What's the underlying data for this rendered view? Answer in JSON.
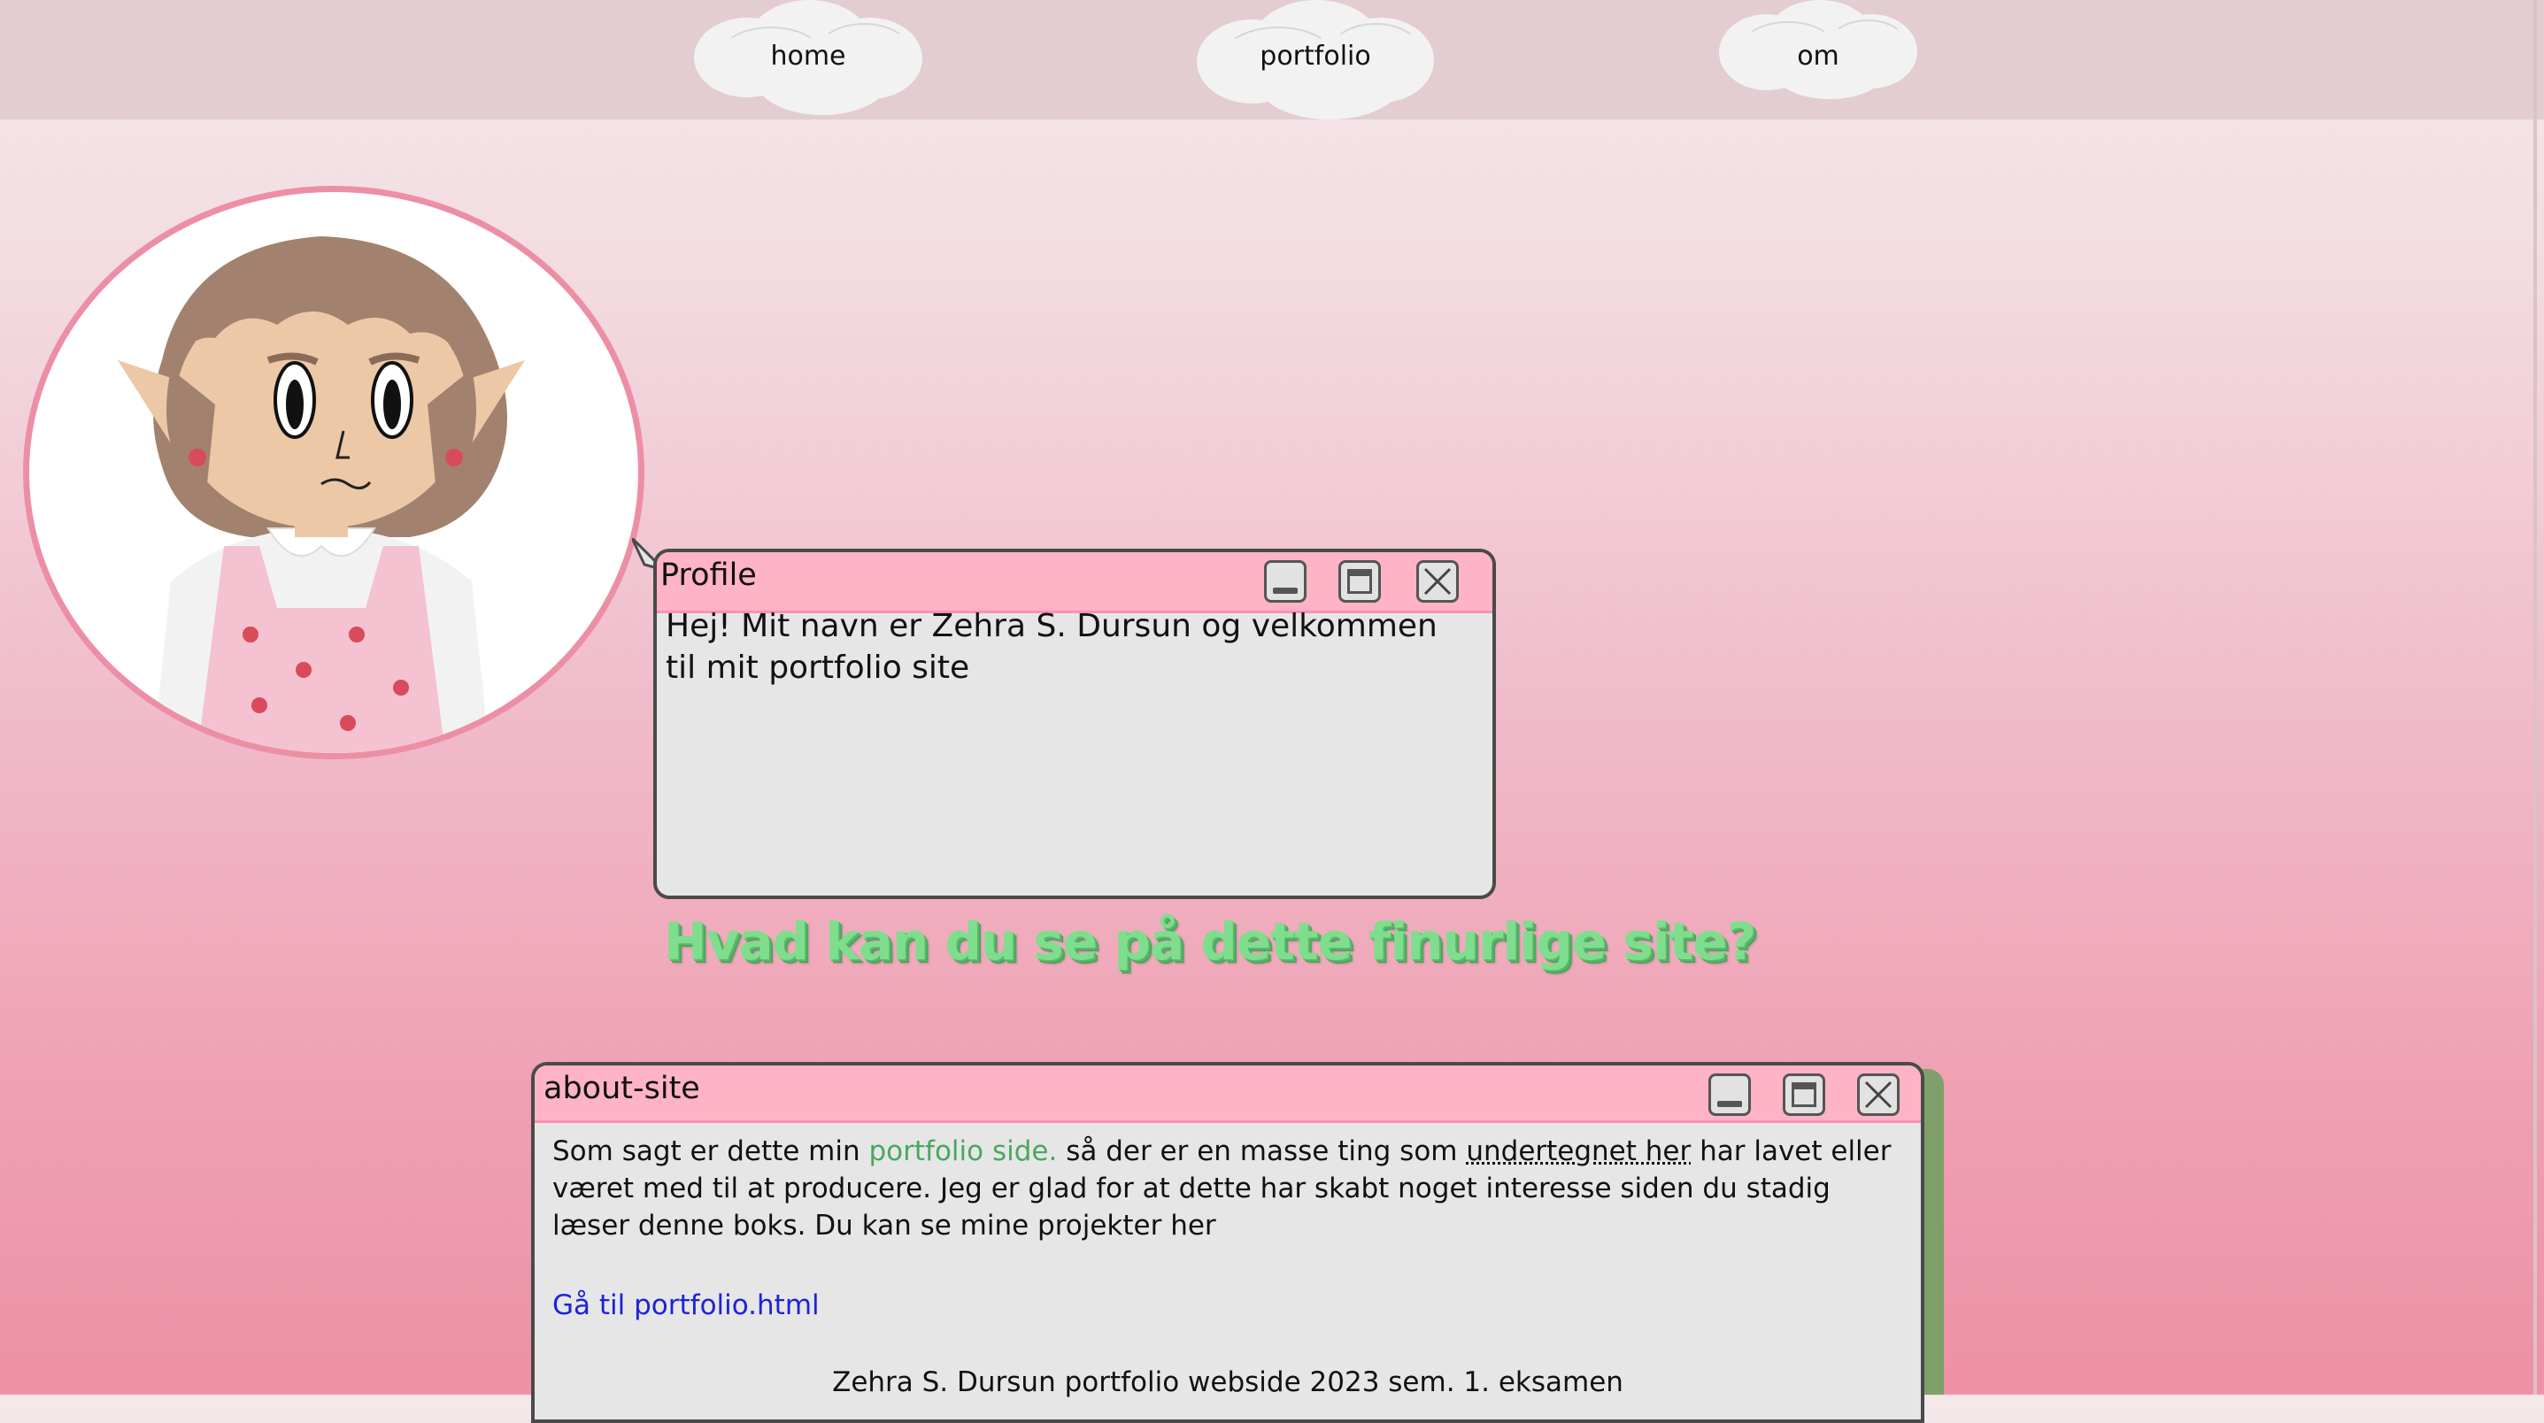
{
  "nav": {
    "items": [
      {
        "label": "home"
      },
      {
        "label": "portfolio"
      },
      {
        "label": "om"
      }
    ]
  },
  "profile_window": {
    "title": "Profile",
    "text": "Hej! Mit navn er Zehra S. Dursun og velkommen til mit portfolio site"
  },
  "heading": "Hvad kan du se på dette finurlige site?",
  "about_window": {
    "title": "about-site",
    "text_before": "Som sagt er dette min ",
    "green_text": "portfolio side.",
    "text_middle": " så der er en masse ting som ",
    "underlined_text": "undertegnet her",
    "text_after": " har lavet eller været med til at producere. Jeg er glad for at dette har skabt noget interesse siden du stadig læser denne boks. Du kan se mine projekter her",
    "link": "Gå til portfolio.html",
    "footer": "Zehra S. Dursun portfolio webside 2023 sem. 1. eksamen"
  },
  "colors": {
    "titlebar": "#ffb3c6",
    "heading": "#7ede8e",
    "link": "#1e22d8",
    "avatar_border": "#ec8fa5"
  },
  "icons": [
    "cloud-icon",
    "minimize-icon",
    "maximize-icon",
    "close-icon"
  ]
}
